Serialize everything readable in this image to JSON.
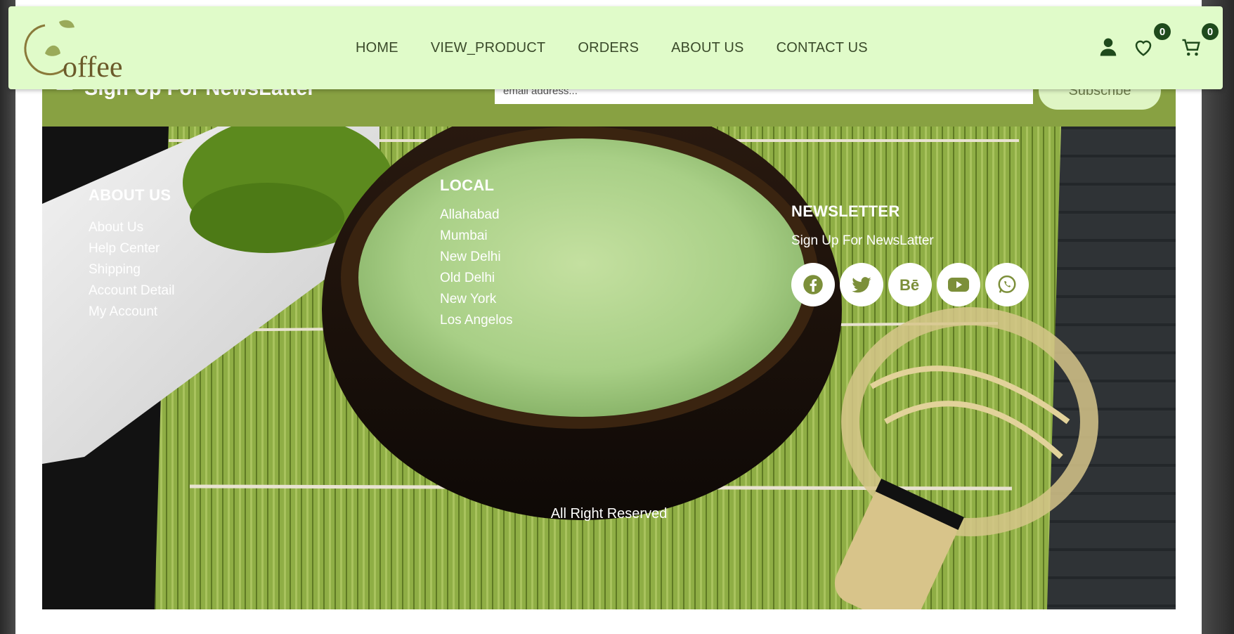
{
  "header": {
    "logo_text": "offee",
    "nav": [
      {
        "label": "HOME"
      },
      {
        "label": "VIEW_PRODUCT"
      },
      {
        "label": "ORDERS"
      },
      {
        "label": "ABOUT US"
      },
      {
        "label": "CONTACT US"
      }
    ],
    "wishlist_count": "0",
    "cart_count": "0",
    "icons": [
      "user-icon",
      "heart-icon",
      "cart-icon"
    ]
  },
  "newsletter_bar": {
    "title": "Sign Up For NewsLatter",
    "email_placeholder": "email address...",
    "subscribe_label": "Subscribe"
  },
  "footer": {
    "about": {
      "heading": "ABOUT US",
      "links": [
        "About Us",
        "Help Center",
        "Shipping",
        "Account Detail",
        "My Account"
      ]
    },
    "local": {
      "heading": "LOCAL",
      "cities": [
        "Allahabad",
        "Mumbai",
        "New Delhi",
        "Old Delhi",
        "New York",
        "Los Angelos"
      ]
    },
    "newsletter": {
      "heading": "NEWSLETTER",
      "text": "Sign Up For NewsLatter",
      "socials": [
        "facebook-icon",
        "twitter-icon",
        "behance-icon",
        "youtube-icon",
        "whatsapp-icon"
      ]
    },
    "copyright": "All Right Reserved"
  },
  "colors": {
    "header_bg": "#e0fbc9",
    "newsletter_bg": "#88a142",
    "badge": "#1f4a1c",
    "nav_text": "#3a4a2a"
  }
}
